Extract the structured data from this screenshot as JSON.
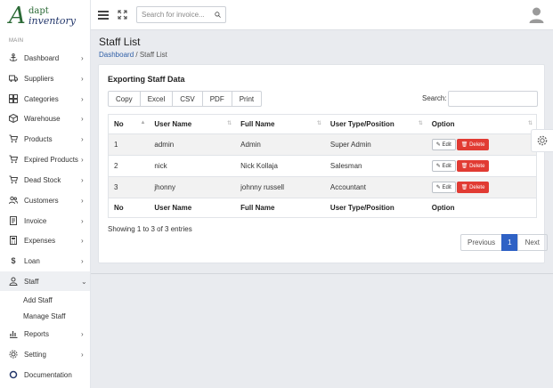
{
  "brand": {
    "mark": "A",
    "line1": "dapt",
    "line2": "inventory"
  },
  "sidebar": {
    "section": "MAIN",
    "items": [
      {
        "label": "Dashboard",
        "icon": "anchor-icon",
        "chevron": "›"
      },
      {
        "label": "Suppliers",
        "icon": "truck-icon",
        "chevron": "›"
      },
      {
        "label": "Categories",
        "icon": "grid-icon",
        "chevron": "›"
      },
      {
        "label": "Warehouse",
        "icon": "box-icon",
        "chevron": "›"
      },
      {
        "label": "Products",
        "icon": "cart-icon",
        "chevron": "›"
      },
      {
        "label": "Expired Products",
        "icon": "cart-x-icon",
        "chevron": "›"
      },
      {
        "label": "Dead Stock",
        "icon": "cart-down-icon",
        "chevron": "›"
      },
      {
        "label": "Customers",
        "icon": "users-icon",
        "chevron": "›"
      },
      {
        "label": "Invoice",
        "icon": "receipt-icon",
        "chevron": "›"
      },
      {
        "label": "Expenses",
        "icon": "calculator-icon",
        "chevron": "›"
      },
      {
        "label": "Loan",
        "icon": "dollar-icon",
        "chevron": "›"
      },
      {
        "label": "Staff",
        "icon": "user-icon",
        "chevron": "⌄"
      },
      {
        "label": "Reports",
        "icon": "chart-icon",
        "chevron": "›"
      },
      {
        "label": "Setting",
        "icon": "gear-icon",
        "chevron": "›"
      },
      {
        "label": "Documentation",
        "icon": "circle-icon",
        "chevron": ""
      }
    ],
    "staff_sub": [
      "Add Staff",
      "Manage Staff"
    ]
  },
  "topbar": {
    "search_placeholder": "Search for invoice..."
  },
  "page": {
    "title": "Staff List",
    "breadcrumb_home": "Dashboard",
    "breadcrumb_sep": "/",
    "breadcrumb_current": "Staff List"
  },
  "card": {
    "title": "Exporting Staff Data",
    "export_buttons": [
      "Copy",
      "Excel",
      "CSV",
      "PDF",
      "Print"
    ],
    "search_label": "Search:"
  },
  "table": {
    "columns": [
      "No",
      "User Name",
      "Full Name",
      "User Type/Position",
      "Option"
    ],
    "rows": [
      {
        "no": "1",
        "username": "admin",
        "fullname": "Admin",
        "type": "Super Admin"
      },
      {
        "no": "2",
        "username": "nick",
        "fullname": "Nick Kollaja",
        "type": "Salesman"
      },
      {
        "no": "3",
        "username": "jhonny",
        "fullname": "johnny russell",
        "type": "Accountant"
      }
    ],
    "edit_label": "Edit",
    "delete_label": "Delete",
    "info": "Showing 1 to 3 of 3 entries"
  },
  "pager": {
    "prev": "Previous",
    "page": "1",
    "next": "Next"
  },
  "colors": {
    "brand_green": "#2b6a36",
    "brand_navy": "#23376b",
    "link": "#2f5fa7",
    "danger": "#e13b33",
    "primary": "#2f62c5"
  }
}
